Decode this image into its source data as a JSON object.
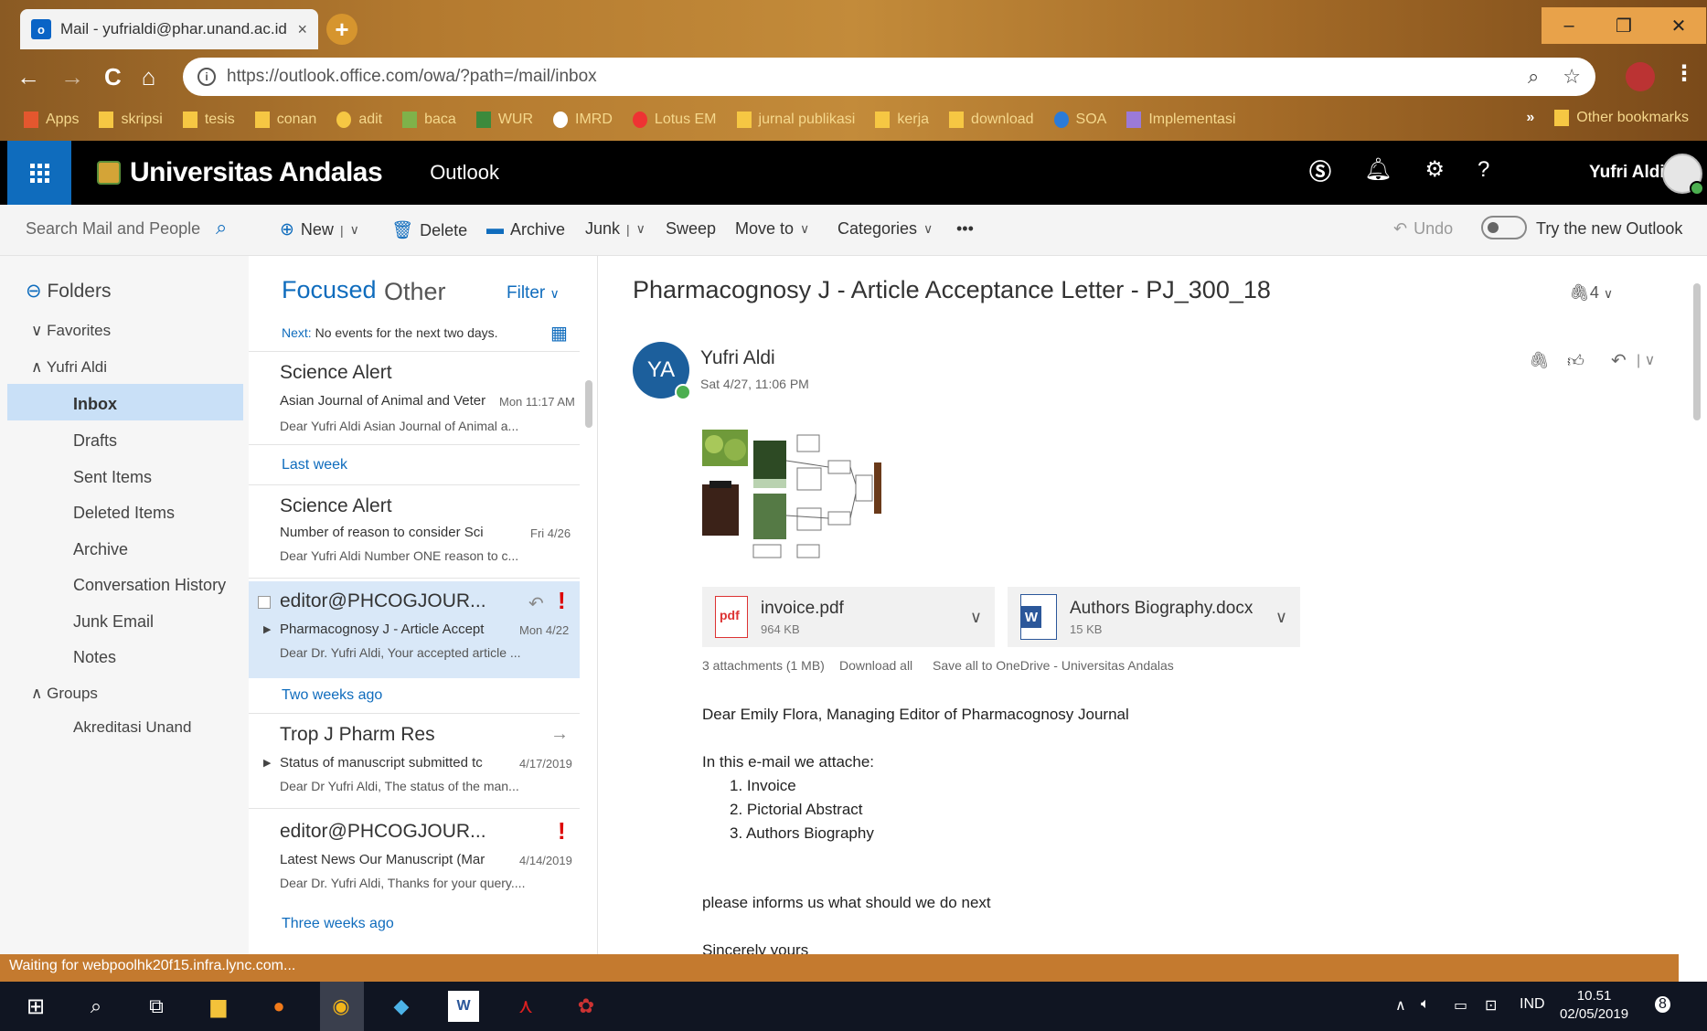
{
  "browser": {
    "tab_title": "Mail - yufrialdi@phar.unand.ac.id",
    "tab_close": "×",
    "new_tab": "+",
    "url": "https://outlook.office.com/owa/?path=/mail/inbox",
    "bookmarks": [
      "Apps",
      "skripsi",
      "tesis",
      "conan",
      "adit",
      "baca",
      "WUR",
      "IMRD",
      "Lotus EM",
      "jurnal publikasi",
      "kerja",
      "download",
      "SOA",
      "Implementasi"
    ],
    "bookmarks_more": "»",
    "other_bookmarks": "Other bookmarks",
    "win_min": "–",
    "win_max": "❐",
    "win_close": "✕"
  },
  "header": {
    "org": "Universitas Andalas",
    "app": "Outlook",
    "user": "Yufri Aldi",
    "help": "?"
  },
  "toolbar": {
    "search_placeholder": "Search Mail and People",
    "new": "New",
    "delete": "Delete",
    "archive": "Archive",
    "junk": "Junk",
    "sweep": "Sweep",
    "move_to": "Move to",
    "categories": "Categories",
    "more": "•••",
    "undo": "Undo",
    "try_new": "Try the new Outlook",
    "sep": "|"
  },
  "folders": {
    "title": "Folders",
    "favorites": "Favorites",
    "account": "Yufri Aldi",
    "items": [
      "Inbox",
      "Drafts",
      "Sent Items",
      "Deleted Items",
      "Archive",
      "Conversation History",
      "Junk Email",
      "Notes"
    ],
    "groups": "Groups",
    "group_items": [
      "Akreditasi Unand"
    ]
  },
  "list": {
    "tab_focused": "Focused",
    "tab_other": "Other",
    "filter": "Filter",
    "next_label": "Next:",
    "next_text": "No events for the next two days.",
    "groups": [
      "Last week",
      "Two weeks ago",
      "Three weeks ago"
    ],
    "messages": [
      {
        "from": "Science Alert",
        "subject": "Asian Journal of Animal and Veter",
        "date": "Mon 11:17 AM",
        "preview": "Dear Yufri Aldi  Asian Journal of Animal a..."
      },
      {
        "from": "Science Alert",
        "subject": "Number of reason to consider Sci",
        "date": "Fri 4/26",
        "preview": "Dear Yufri Aldi  Number ONE reason to c..."
      },
      {
        "from": "editor@PHCOGJOUR...",
        "subject": "Pharmacognosy J - Article Accept",
        "date": "Mon 4/22",
        "preview": "Dear Dr. Yufri Aldi,  Your accepted article ..."
      },
      {
        "from": "Trop J Pharm Res",
        "subject": "Status of manuscript submitted tc",
        "date": "4/17/2019",
        "preview": "Dear Dr Yufri Aldi,  The status of the man..."
      },
      {
        "from": "editor@PHCOGJOUR...",
        "subject": "Latest News Our Manuscript (Mar",
        "date": "4/14/2019",
        "preview": "Dear Dr. Yufri Aldi, Thanks for your query...."
      }
    ],
    "flag": "!"
  },
  "reading": {
    "subject": "Pharmacognosy J - Article Acceptance Letter - PJ_300_18",
    "attach_count": "4",
    "sender_initials": "YA",
    "sender": "Yufri Aldi",
    "sent": "Sat 4/27, 11:06 PM",
    "attachments": [
      {
        "name": "invoice.pdf",
        "size": "964 KB"
      },
      {
        "name": "Authors Biography.docx",
        "size": "15 KB"
      }
    ],
    "attach_summary": "3 attachments (1 MB)",
    "download_all": "Download all",
    "save_onedrive": "Save all to OneDrive - Universitas Andalas",
    "greeting": "Dear Emily Flora, Managing Editor of Pharmacognosy Journal",
    "intro": "In this e-mail we attache:",
    "list": [
      "1. Invoice",
      "2. Pictorial Abstract",
      "3. Authors Biography"
    ],
    "ask": "please informs us what should we do next",
    "signoff": "Sincerely yours"
  },
  "status": "Waiting for webpoolhk20f15.infra.lync.com...",
  "taskbar": {
    "lang": "IND",
    "time": "10.51",
    "date": "02/05/2019",
    "notif": "8"
  }
}
